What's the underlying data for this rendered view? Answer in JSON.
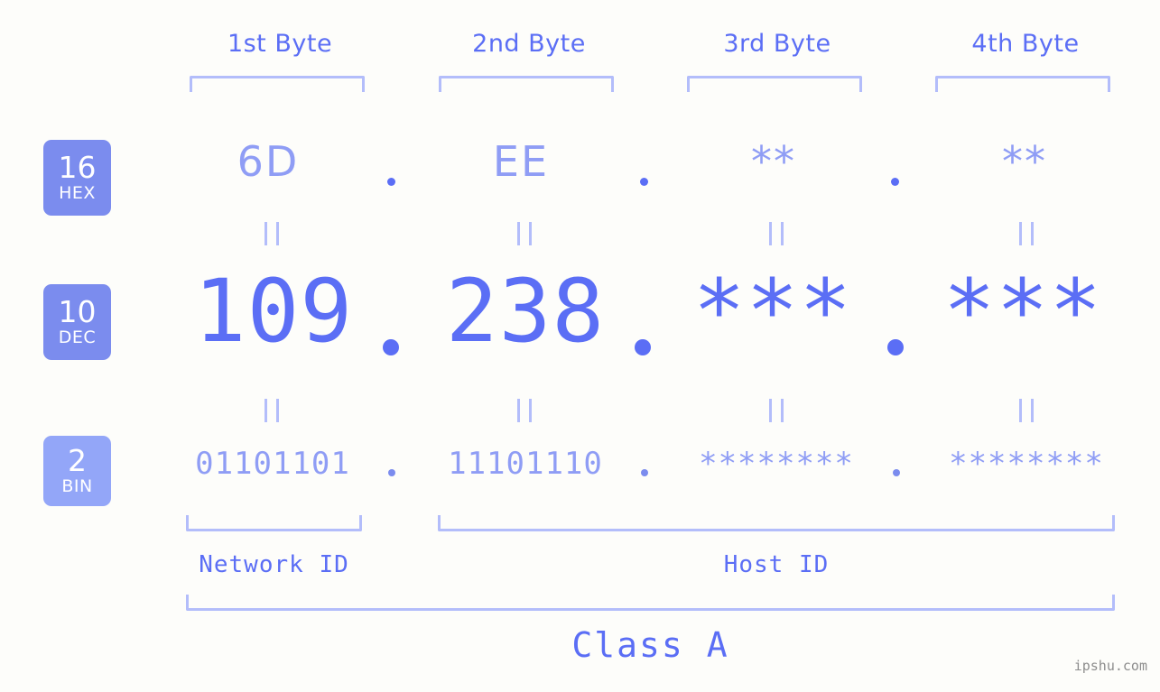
{
  "site": {
    "watermark": "ipshu.com"
  },
  "columns": [
    {
      "label": "1st Byte"
    },
    {
      "label": "2nd Byte"
    },
    {
      "label": "3rd Byte"
    },
    {
      "label": "4th Byte"
    }
  ],
  "rows": [
    {
      "key": "hex",
      "badge_number": "16",
      "badge_radix": "HEX",
      "values": [
        "6D",
        "EE",
        "**",
        "**"
      ]
    },
    {
      "key": "dec",
      "badge_number": "10",
      "badge_radix": "DEC",
      "values": [
        "109",
        "238",
        "***",
        "***"
      ]
    },
    {
      "key": "bin",
      "badge_number": "2",
      "badge_radix": "BIN",
      "values": [
        "01101101",
        "11101110",
        "********",
        "********"
      ]
    }
  ],
  "separators": {
    "dot": "."
  },
  "equals_marks": {
    "glyph": "||"
  },
  "sections": {
    "network_id": "Network ID",
    "host_id": "Host ID",
    "class": "Class A"
  },
  "colors": {
    "background": "#fdfdfa",
    "accent_strong": "#5b6ef5",
    "accent_mid": "#7b8cee",
    "accent_soft": "#8f9df5",
    "accent_pale": "#b3bdfa",
    "badge_bg": "#7b8cee",
    "badge_bg_light": "#93a6f8",
    "badge_text": "#ffffff",
    "watermark_text": "#8d8d8d"
  }
}
